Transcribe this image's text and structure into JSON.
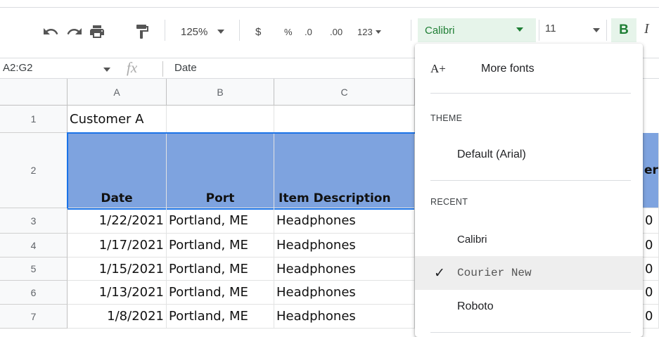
{
  "toolbar": {
    "zoom": "125%",
    "currency": "$",
    "percent": "%",
    "decrease_decimal": ".0",
    "increase_decimal": ".00",
    "more_formats": "123",
    "font": "Calibri",
    "font_size": "11",
    "bold": "B",
    "italic": "I",
    "icons": [
      "undo-icon",
      "redo-icon",
      "print-icon",
      "paint-format-icon"
    ],
    "accent_color": "#1e7e34",
    "active_bg": "#e6f4ea"
  },
  "formula_bar": {
    "name_box": "A2:G2",
    "fx": "fx",
    "value": "Date"
  },
  "grid": {
    "columns": [
      "A",
      "B",
      "C"
    ],
    "row_numbers": [
      "1",
      "2",
      "3",
      "4",
      "5",
      "6",
      "7"
    ],
    "row1": {
      "a": "Customer A"
    },
    "headers": {
      "a": "Date",
      "b": "Port",
      "c": "Item Description",
      "e": "er"
    },
    "header_fill": "#7ea3df",
    "rows": [
      {
        "date": "1/22/2021",
        "port": "Portland, ME",
        "item": "Headphones",
        "e": "0"
      },
      {
        "date": "1/17/2021",
        "port": "Portland, ME",
        "item": "Headphones",
        "e": "0"
      },
      {
        "date": "1/15/2021",
        "port": "Portland, ME",
        "item": "Headphones",
        "e": "0"
      },
      {
        "date": "1/13/2021",
        "port": "Portland, ME",
        "item": "Headphones",
        "e": "0"
      },
      {
        "date": "1/8/2021",
        "port": "Portland, ME",
        "item": "Headphones",
        "e": "0"
      }
    ]
  },
  "font_menu": {
    "more_fonts": "More fonts",
    "theme_label": "THEME",
    "theme_font": "Default (Arial)",
    "recent_label": "RECENT",
    "recent": [
      "Calibri",
      "Courier New",
      "Roboto"
    ],
    "checked_font": "Courier New",
    "check": "✓",
    "more_fonts_icon": "A+"
  }
}
